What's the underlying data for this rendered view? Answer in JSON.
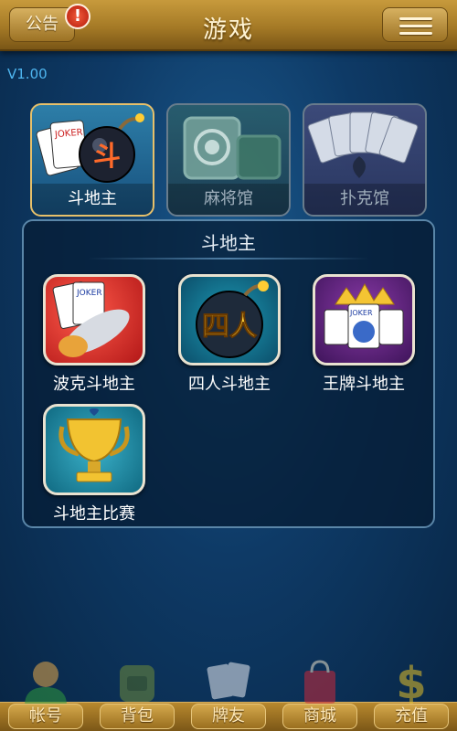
{
  "header": {
    "title": "游戏",
    "notice_label": "公告",
    "notice_alert": "!"
  },
  "version": "V1.00",
  "categories": [
    {
      "label": "斗地主",
      "state": "active",
      "art": "斗"
    },
    {
      "label": "麻将馆",
      "state": "inactive"
    },
    {
      "label": "扑克馆",
      "state": "inactive"
    }
  ],
  "panel": {
    "title": "斗地主",
    "games": [
      {
        "label": "波克斗地主",
        "icon": "rocket-joker-icon"
      },
      {
        "label": "四人斗地主",
        "icon": "bomb-four-icon",
        "art": "四人"
      },
      {
        "label": "王牌斗地主",
        "icon": "wizard-king-icon"
      },
      {
        "label": "斗地主比赛",
        "icon": "trophy-icon"
      }
    ]
  },
  "bottom_tabs": [
    {
      "label": "帐号",
      "icon": "account-icon"
    },
    {
      "label": "背包",
      "icon": "backpack-icon"
    },
    {
      "label": "牌友",
      "icon": "cards-icon"
    },
    {
      "label": "商城",
      "icon": "shop-bag-icon"
    },
    {
      "label": "充值",
      "icon": "dollar-icon"
    }
  ],
  "colors": {
    "accent_gold": "#c79a3c",
    "background": "#0e3a66",
    "version_text": "#4fb6f0"
  }
}
